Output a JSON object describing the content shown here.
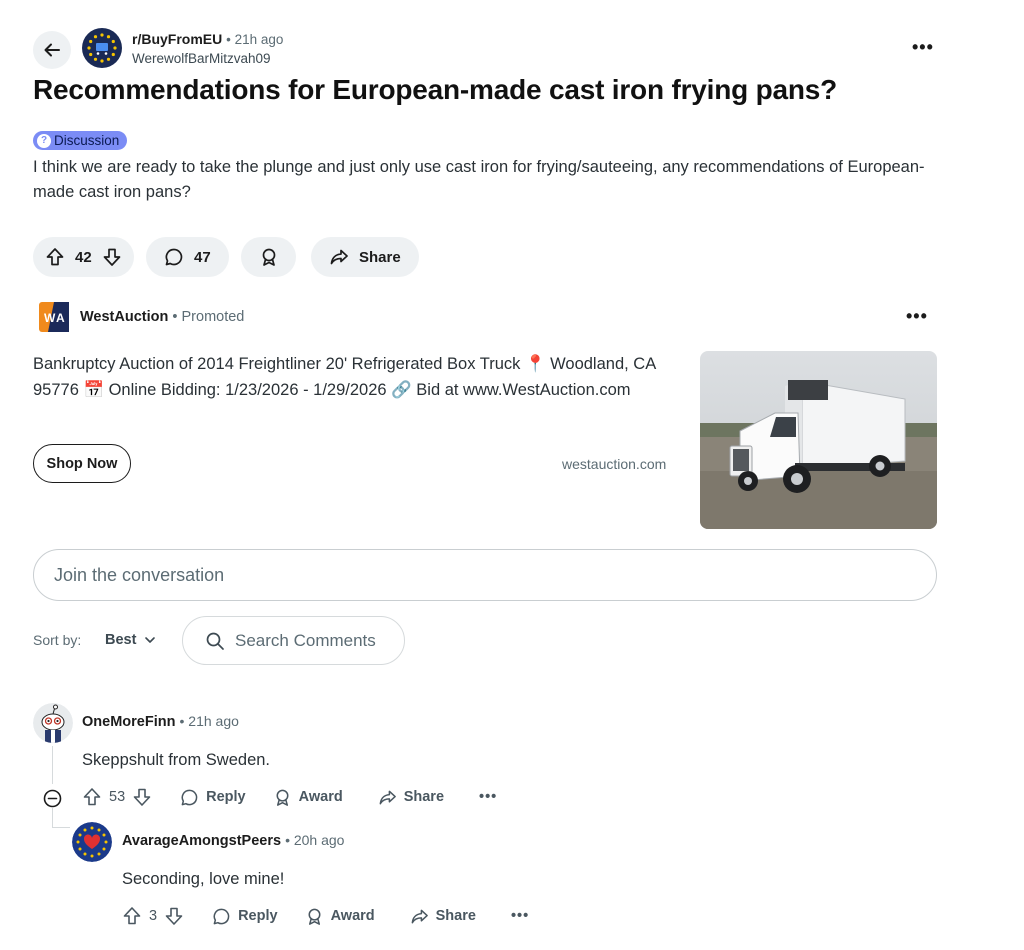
{
  "post": {
    "subreddit": "r/BuyFromEU",
    "time": "21h ago",
    "author": "WerewolfBarMitzvah09",
    "title": "Recommendations for European-made cast iron frying pans?",
    "flair": "Discussion",
    "body": "I think we are ready to take the plunge and just only use cast iron for frying/sauteeing, any recommendations of European-made cast iron pans?",
    "upvotes": "42",
    "comments": "47",
    "share_label": "Share"
  },
  "ad": {
    "name": "WestAuction",
    "promoted": "Promoted",
    "text": "Bankruptcy Auction of 2014 Freightliner 20' Refrigerated Box Truck 📍 Woodland, CA 95776 📅 Online Bidding: 1/23/2026 - 1/29/2026 🔗 Bid at www.WestAuction.com",
    "button": "Shop Now",
    "domain": "westauction.com"
  },
  "join": {
    "placeholder": "Join the conversation"
  },
  "sort": {
    "label": "Sort by:",
    "value": "Best"
  },
  "search_comments": {
    "placeholder": "Search Comments"
  },
  "comments": [
    {
      "author": "OneMoreFinn",
      "time": "21h ago",
      "body": "Skeppshult from Sweden.",
      "score": "53",
      "reply": "Reply",
      "award": "Award",
      "share": "Share"
    },
    {
      "author": "AvarageAmongstPeers",
      "time": "20h ago",
      "body": "Seconding, love mine!",
      "score": "3",
      "reply": "Reply",
      "award": "Award",
      "share": "Share"
    }
  ],
  "colors": {
    "flair_bg": "#7b8cf5",
    "pill_bg": "#eef1f3",
    "text": "#1c1c1c"
  }
}
